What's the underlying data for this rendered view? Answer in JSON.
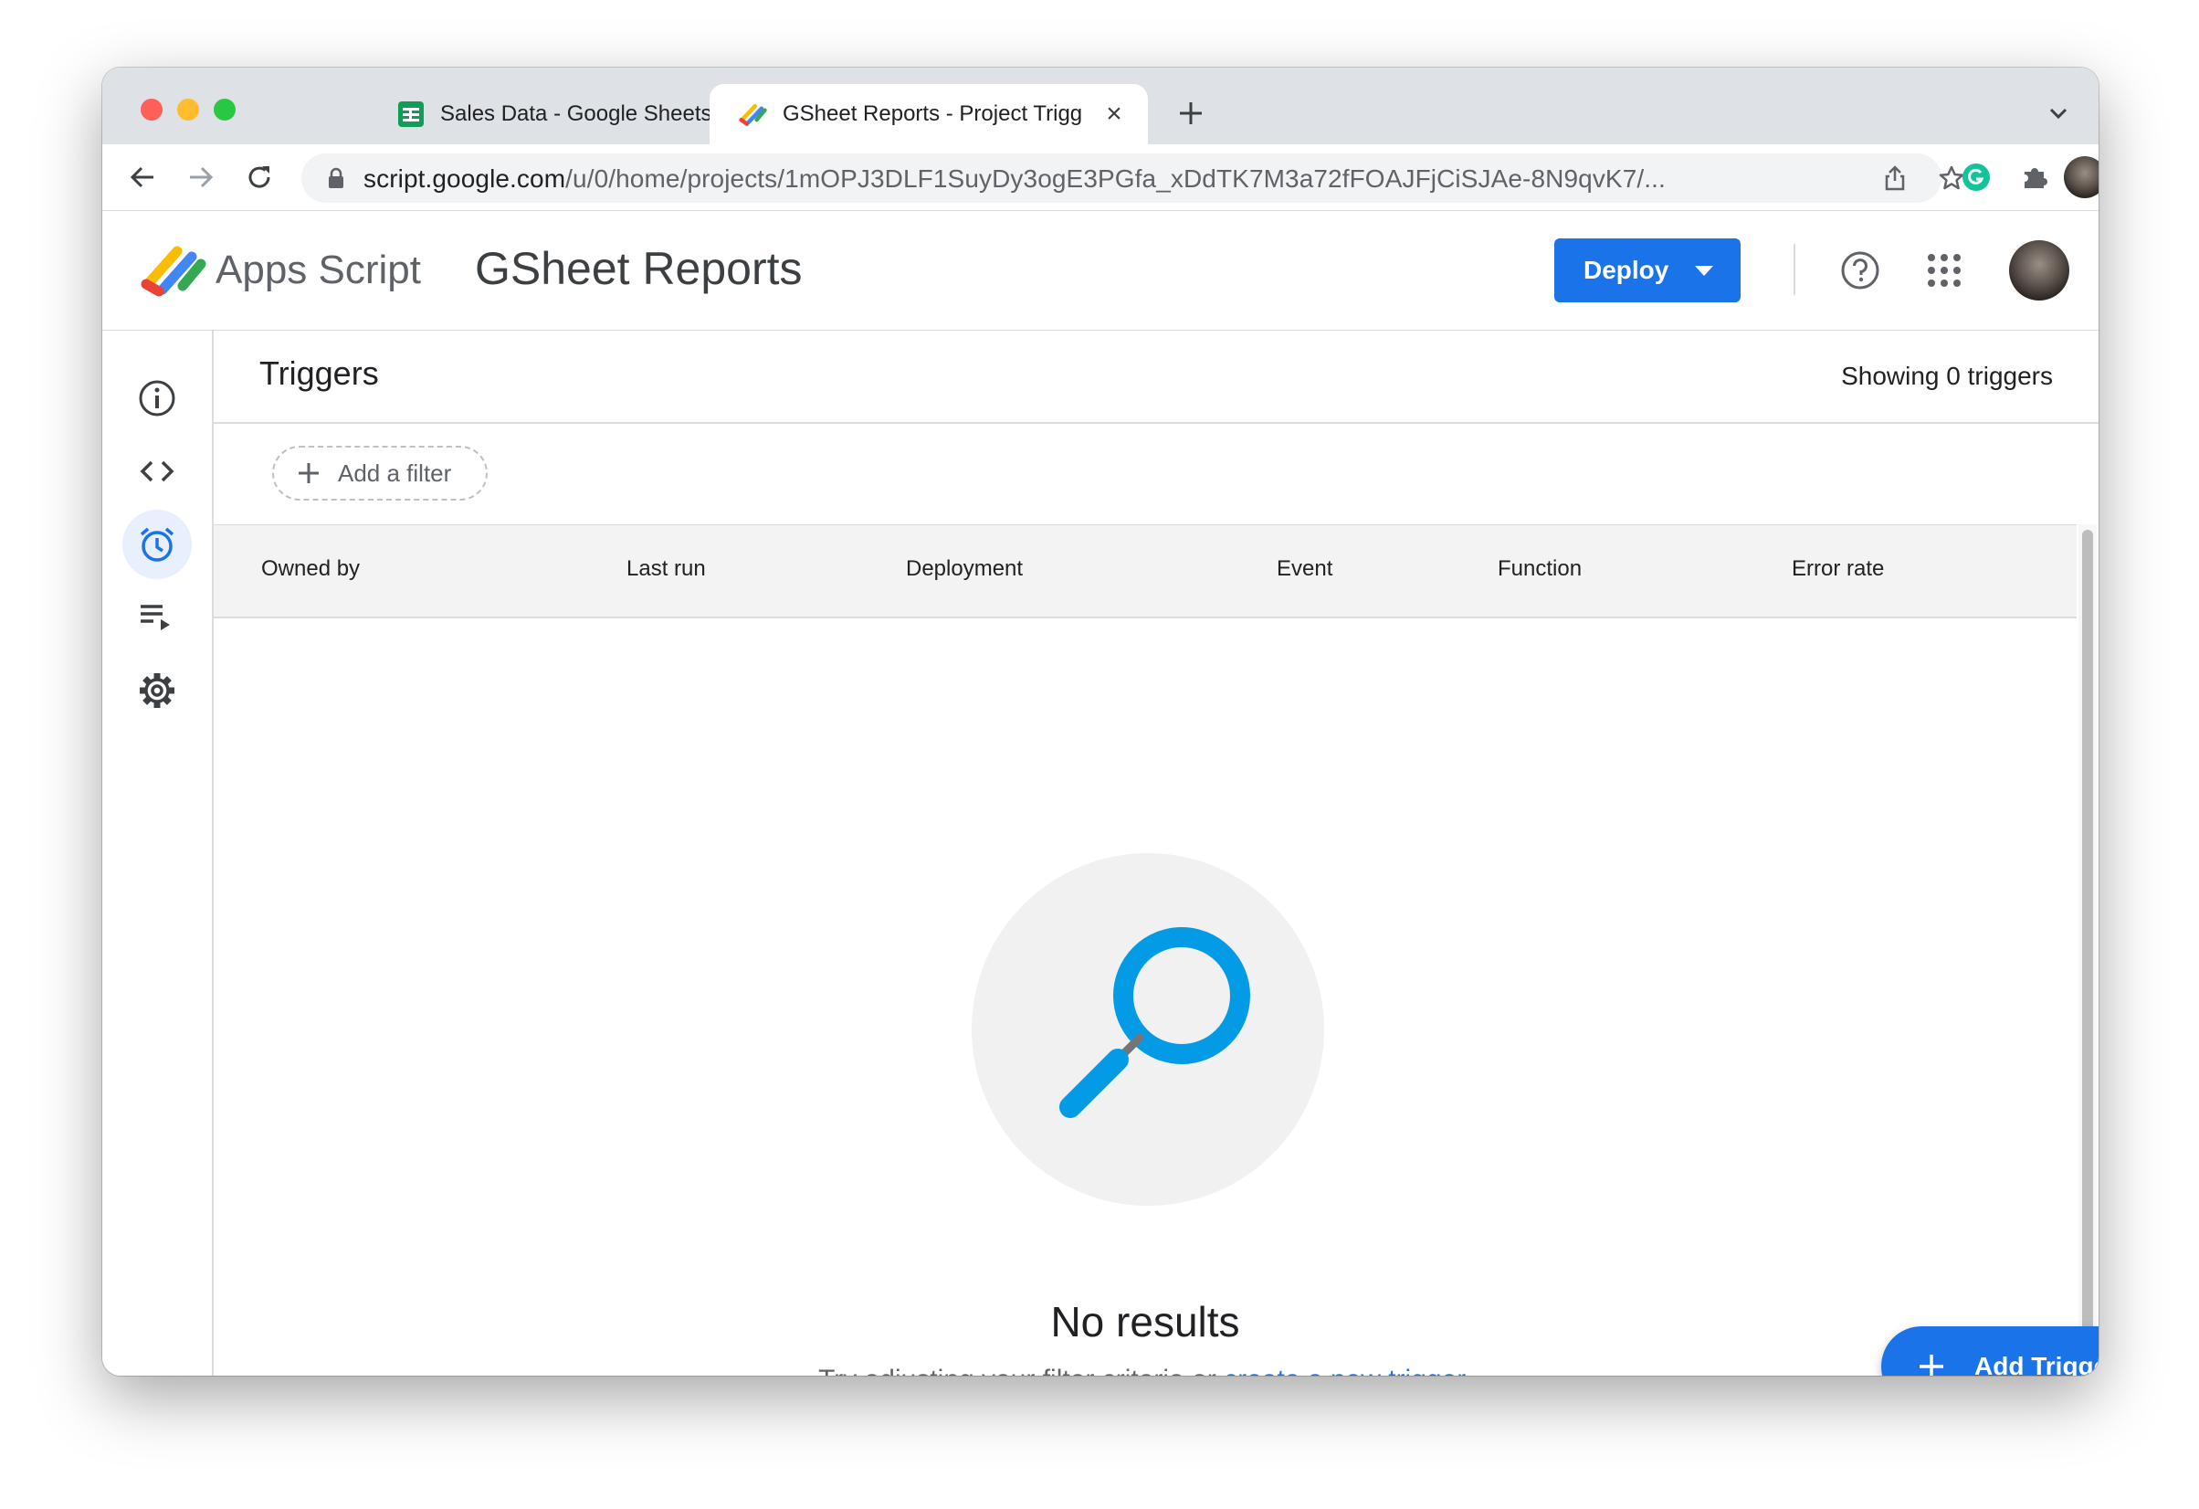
{
  "browser": {
    "tabs": [
      {
        "title": "Sales Data - Google Sheets",
        "icon": "google-sheets-icon",
        "active": false
      },
      {
        "title": "GSheet Reports - Project Trigg",
        "icon": "apps-script-icon",
        "active": true
      }
    ],
    "close_glyph": "×",
    "url_host": "script.google.com",
    "url_path": "/u/0/home/projects/1mOPJ3DLF1SuyDy3ogE3PGfa_xDdTK7M3a72fFOAJFjCiSJAe-8N9qvK7/..."
  },
  "header": {
    "product_name": "Apps Script",
    "project_name": "GSheet Reports",
    "deploy_label": "Deploy"
  },
  "rail": {
    "items": [
      {
        "name": "overview",
        "icon": "info-icon",
        "active": false
      },
      {
        "name": "editor",
        "icon": "code-icon",
        "active": false
      },
      {
        "name": "triggers",
        "icon": "alarm-clock-icon",
        "active": true
      },
      {
        "name": "executions",
        "icon": "playlist-play-icon",
        "active": false
      },
      {
        "name": "settings",
        "icon": "gear-icon",
        "active": false
      }
    ]
  },
  "main": {
    "title": "Triggers",
    "showing": "Showing 0 triggers",
    "filter_label": "Add a filter",
    "columns": [
      "Owned by",
      "Last run",
      "Deployment",
      "Event",
      "Function",
      "Error rate"
    ],
    "empty_title": "No results",
    "empty_hint": "Try adjusting your filter criteria or",
    "empty_link": "create a new trigger.",
    "add_trigger_label": "Add Trigger"
  },
  "colors": {
    "accent": "#1a73e8",
    "search_illustration": "#039be5"
  }
}
